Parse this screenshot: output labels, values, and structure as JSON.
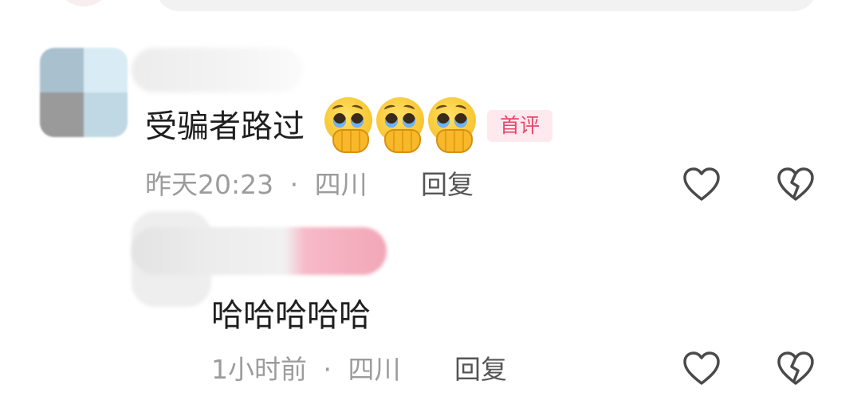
{
  "comment": {
    "text": "受骗者路过",
    "emojis": [
      "pleading-cry-emoji",
      "pleading-cry-emoji",
      "pleading-cry-emoji"
    ],
    "badge": "首评",
    "time": "昨天20:23",
    "separator": "·",
    "location": "四川",
    "reply_label": "回复"
  },
  "reply": {
    "text": "哈哈哈哈哈",
    "time": "1小时前",
    "separator": "·",
    "location": "四川",
    "reply_label": "回复"
  },
  "icons": {
    "like": "heart-outline-icon",
    "dislike": "broken-heart-icon"
  },
  "colors": {
    "badge_bg": "#fde9ee",
    "badge_text": "#e9456b",
    "meta": "#9c9c9c"
  }
}
